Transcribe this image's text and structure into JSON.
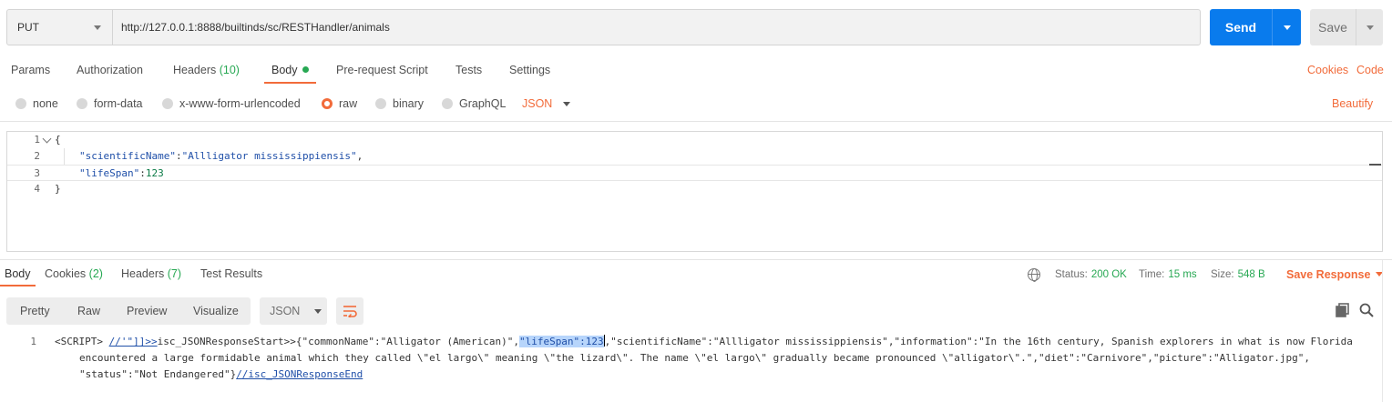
{
  "request": {
    "method": "PUT",
    "url": "http://127.0.0.1:8888/builtinds/sc/RESTHandler/animals",
    "send_label": "Send",
    "save_label": "Save"
  },
  "request_tabs": [
    {
      "label": "Params"
    },
    {
      "label": "Authorization"
    },
    {
      "label": "Headers",
      "count": "(10)"
    },
    {
      "label": "Body",
      "active": true
    },
    {
      "label": "Pre-request Script"
    },
    {
      "label": "Tests"
    },
    {
      "label": "Settings"
    }
  ],
  "links": {
    "cookies": "Cookies",
    "code": "Code",
    "beautify": "Beautify"
  },
  "body_types": [
    "none",
    "form-data",
    "x-www-form-urlencoded",
    "raw",
    "binary",
    "GraphQL"
  ],
  "body_type_selected": "raw",
  "body_format": "JSON",
  "editor": {
    "lines": [
      {
        "num": "1",
        "text": "{"
      },
      {
        "num": "2",
        "key": "\"scientificName\"",
        "sep": ":",
        "value": "\"Allligator mississippiensis\"",
        "tail": ","
      },
      {
        "num": "3",
        "key": "\"lifeSpan\"",
        "sep": ":",
        "value": "123",
        "tail": ""
      },
      {
        "num": "4",
        "text": "}"
      }
    ]
  },
  "response_tabs": [
    {
      "label": "Body",
      "active": true
    },
    {
      "label": "Cookies",
      "count": "(2)"
    },
    {
      "label": "Headers",
      "count": "(7)"
    },
    {
      "label": "Test Results"
    }
  ],
  "status": {
    "status_label": "Status:",
    "status_value": "200 OK",
    "time_label": "Time:",
    "time_value": "15 ms",
    "size_label": "Size:",
    "size_value": "548 B",
    "save_response": "Save Response"
  },
  "view_modes": [
    "Pretty",
    "Raw",
    "Preview",
    "Visualize"
  ],
  "response_format": "JSON",
  "response": {
    "line_num": "1",
    "seg_tag": "<SCRIPT> ",
    "seg_cmt1": "//'\"]]>>",
    "seg_a": "isc_JSONResponseStart>>{\"commonName\":\"Alligator (American)\",",
    "seg_hl": "\"lifeSpan\":123",
    "seg_b": ",\"scientificName\":\"Allligator mississippiensis\",\"information\":\"In the 16th century, Spanish explorers in what is now Florida",
    "line2": "encountered a large formidable animal which they called \\\"el largo\\\" meaning \\\"the lizard\\\". The name \\\"el largo\\\" gradually became pronounced \\\"alligator\\\".\",\"diet\":\"Carnivore\",\"picture\":\"Alligator.jpg\",",
    "line3_a": "\"status\":\"Not Endangered\"}",
    "line3_cmt": "//isc_JSONResponseEnd"
  }
}
